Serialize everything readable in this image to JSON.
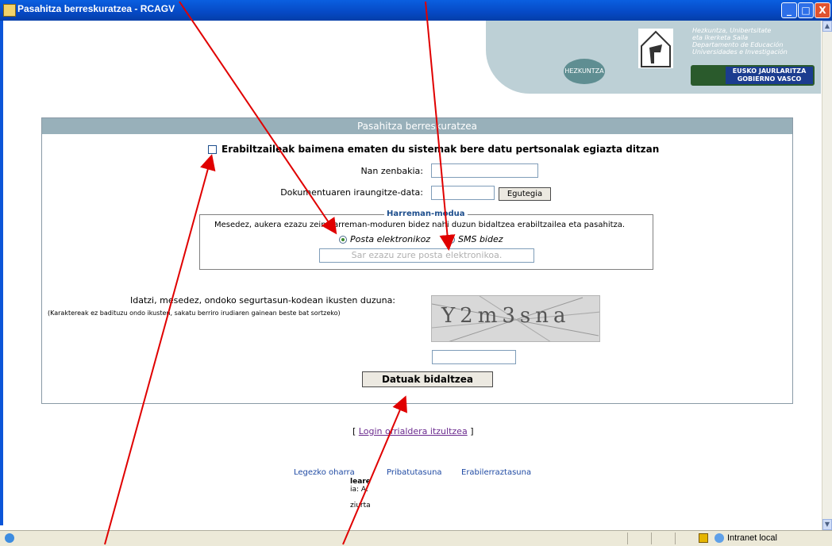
{
  "window": {
    "title": "Pasahitza berreskuratzea - RCAGV",
    "minimize": "_",
    "maximize": "□",
    "close": "X"
  },
  "banner": {
    "text_line1": "Hezkuntza, Unibertsitate",
    "text_line2": "eta Ikerketa Saila",
    "text_line3": "Departamento de Educación",
    "text_line4": "Universidades e Investigación",
    "hezkuntza": "HEZKUNTZA",
    "gov_line1": "EUSKO JAURLARITZA",
    "gov_line2": "GOBIERNO VASCO"
  },
  "form": {
    "header": "Pasahitza berreskuratzea",
    "consent_label": "Erabiltzaileak baimena ematen du sistemak bere datu pertsonalak egiazta ditzan",
    "nan_label": "Nan zenbakia:",
    "nan_value": "",
    "expiry_label": "Dokumentuaren iraungitze-data:",
    "expiry_value": "",
    "calendar_button": "Egutegia",
    "contact_legend": "Harreman-modua",
    "contact_text": "Mesedez, aukera ezazu zein harreman-moduren bidez nahi duzun bidaltzea erabiltzailea eta pasahitza.",
    "email_option": "Posta elektronikoz",
    "sms_option": "SMS bidez",
    "email_placeholder": "Sar ezazu zure posta elektronikoa.",
    "captcha_label": "Idatzi, mesedez, ondoko segurtasun-kodean ikusten duzuna:",
    "captcha_hint": "(Karaktereak ez badituzu ondo ikusten, sakatu berriro irudiaren gainean beste bat sortzeko)",
    "captcha_text": "Y2m3sna",
    "captcha_value": "",
    "submit_button": "Datuak bidaltzea"
  },
  "footer": {
    "back_prefix": "[",
    "back_link": "Login orrialdera itzultzea",
    "back_suffix": "]",
    "legal": "Legezko oharra",
    "privacy": "Pribatutasuna",
    "accessibility": "Erabilerraztasuna",
    "frag1": "leare",
    "frag2": "ia: A:",
    "frag3": "ziurta"
  },
  "status": {
    "zone": "Intranet local"
  }
}
